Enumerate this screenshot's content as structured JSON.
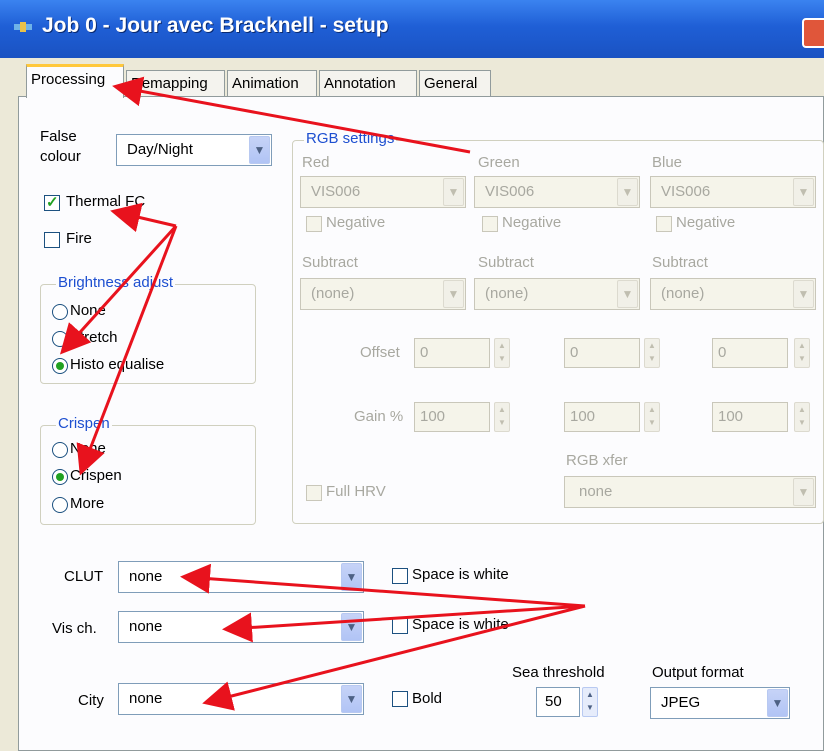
{
  "window": {
    "title": "Job 0 - Jour avec Bracknell - setup",
    "icon": "satellite-app-icon",
    "close_icon": "close-icon"
  },
  "tabs": [
    "Processing",
    "Remapping",
    "Animation",
    "Annotation",
    "General"
  ],
  "false_colour": {
    "label_line1": "False",
    "label_line2": "colour",
    "value": "Day/Night"
  },
  "thermal_fc": {
    "label": "Thermal FC",
    "checked": true
  },
  "fire": {
    "label": "Fire",
    "checked": false
  },
  "brightness": {
    "title": "Brightness adjust",
    "options": [
      "None",
      "Stretch",
      "Histo equalise"
    ],
    "selected": "Histo equalise"
  },
  "crispen": {
    "title": "Crispen",
    "options": [
      "None",
      "Crispen",
      "More"
    ],
    "selected": "Crispen"
  },
  "rgb": {
    "title": "RGB settings",
    "red": {
      "label": "Red",
      "channel": "VIS006",
      "negative": "Negative",
      "subtract_label": "Subtract",
      "subtract": "(none)"
    },
    "green": {
      "label": "Green",
      "channel": "VIS006",
      "negative": "Negative",
      "subtract_label": "Subtract",
      "subtract": "(none)"
    },
    "blue": {
      "label": "Blue",
      "channel": "VIS006",
      "negative": "Negative",
      "subtract_label": "Subtract",
      "subtract": "(none)"
    },
    "offset_label": "Offset",
    "offsets": [
      "0",
      "0",
      "0"
    ],
    "gain_label": "Gain %",
    "gains": [
      "100",
      "100",
      "100"
    ],
    "rgb_xfer_label": "RGB xfer",
    "rgb_xfer": "none",
    "full_hrv": "Full HRV"
  },
  "clut": {
    "label": "CLUT",
    "value": "none",
    "space_white": "Space is white"
  },
  "vis_ch": {
    "label": "Vis ch.",
    "value": "none",
    "space_white": "Space is white"
  },
  "city": {
    "label": "City",
    "value": "none",
    "bold": "Bold"
  },
  "sea_threshold": {
    "label": "Sea threshold",
    "value": "50"
  },
  "output_format": {
    "label": "Output format",
    "value": "JPEG"
  },
  "annotation_color": "#e8121d"
}
